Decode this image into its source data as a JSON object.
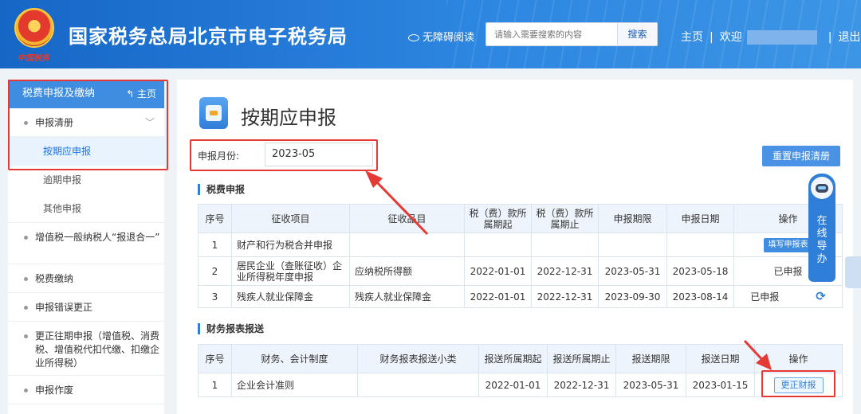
{
  "header": {
    "site_title": "国家税务总局北京市电子税务局",
    "emblem_script": "中国税务",
    "accessibility_label": "无障碍阅读",
    "search_placeholder": "请输入需要搜索的内容",
    "search_button": "搜索",
    "home_link": "主页",
    "separator": "|",
    "welcome_text": "欢迎",
    "logout_link": "退出"
  },
  "sidebar": {
    "header_label": "税费申报及缴纳",
    "home_label": "主页",
    "items": [
      {
        "label": "申报清册",
        "level": 1
      },
      {
        "label": "按期应申报",
        "level": 2,
        "active": true
      },
      {
        "label": "逾期申报",
        "level": 2
      },
      {
        "label": "其他申报",
        "level": 2
      },
      {
        "label": "增值税一般纳税人“报退合一”",
        "level": 1
      },
      {
        "label": "税费缴纳",
        "level": 1
      },
      {
        "label": "申报错误更正",
        "level": 1
      },
      {
        "label": "更正往期申报（增值税、消费税、增值税代扣代缴、扣缴企业所得税）",
        "level": 1
      },
      {
        "label": "申报作废",
        "level": 1
      }
    ]
  },
  "main": {
    "page_title": "按期应申报",
    "month_label": "申报月份:",
    "month_value": "2023-05",
    "reset_button": "重置申报清册",
    "tax_section": {
      "title": "税费申报",
      "headers": [
        "序号",
        "征收项目",
        "征收品目",
        "税（费）款所属期起",
        "税（费）款所属期止",
        "申报期限",
        "申报日期",
        "操作"
      ],
      "rows": [
        {
          "no": "1",
          "item": "财产和行为税合并申报",
          "sub": "",
          "start": "",
          "end": "",
          "deadline": "",
          "date": "",
          "action": "填写申报表",
          "action_type": "button"
        },
        {
          "no": "2",
          "item": "居民企业（查账征收）企业所得税年度申报",
          "sub": "应纳税所得额",
          "start": "2022-01-01",
          "end": "2022-12-31",
          "deadline": "2023-05-31",
          "date": "2023-05-18",
          "action": "已申报",
          "action_type": "text"
        },
        {
          "no": "3",
          "item": "残疾人就业保障金",
          "sub": "残疾人就业保障金",
          "start": "2022-01-01",
          "end": "2022-12-31",
          "deadline": "2023-09-30",
          "date": "2023-08-14",
          "action": "已申报",
          "action_type": "text"
        }
      ]
    },
    "finance_section": {
      "title": "财务报表报送",
      "headers": [
        "序号",
        "财务、会计制度",
        "财务报表报送小类",
        "报送所属期起",
        "报送所属期止",
        "报送期限",
        "报送日期",
        "操作"
      ],
      "rows": [
        {
          "no": "1",
          "system": "企业会计准则",
          "sub": "",
          "start": "2022-01-01",
          "end": "2022-12-31",
          "deadline": "2023-05-31",
          "date": "2023-01-15",
          "action": "更正财报"
        }
      ]
    }
  },
  "float_guide": {
    "label": "在线导办"
  },
  "colors": {
    "accent": "#2f7ed8",
    "annotation_red": "#e53935",
    "header_blue": "#1666c6"
  }
}
